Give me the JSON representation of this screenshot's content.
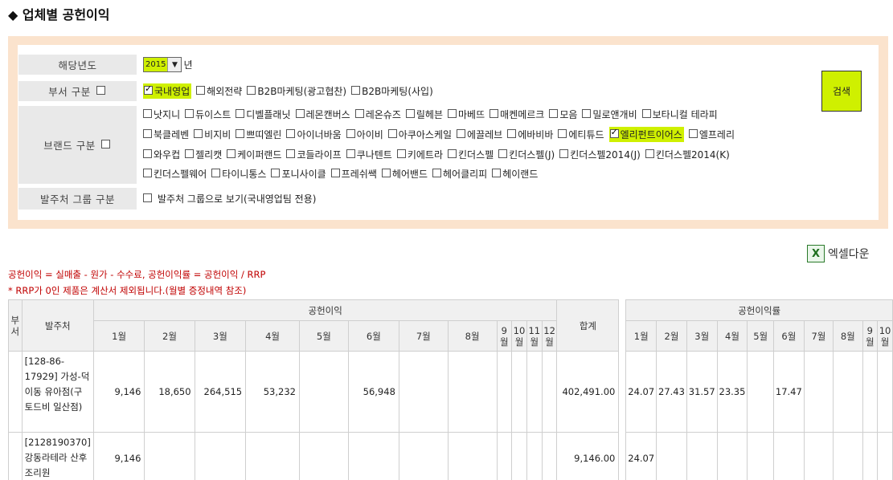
{
  "page": {
    "title": "◆ 업체별 공헌이익"
  },
  "filters": {
    "year": {
      "label": "해당년도",
      "value": "2015",
      "unit": "년"
    },
    "dept": {
      "label": "부서 구분",
      "options": [
        {
          "label": "국내영업",
          "checked": true,
          "highlight": true
        },
        {
          "label": "해외전략",
          "checked": false
        },
        {
          "label": "B2B마케팅(광고협찬)",
          "checked": false
        },
        {
          "label": "B2B마케팅(사입)",
          "checked": false
        }
      ]
    },
    "brand": {
      "label": "브랜드 구분",
      "lines": [
        [
          "낫지니",
          "듀이스트",
          "디벨플래닛",
          "레몬캔버스",
          "레온슈즈",
          "릴헤븐",
          "마베뜨",
          "매켄메르크",
          "모음",
          "밀로앤개비",
          "보타니컬 테라피"
        ],
        [
          "북클레벤",
          "비지비",
          "쁘띠엘린",
          "아이너바움",
          "아이비",
          "아쿠아스케일",
          "에끌레브",
          "에바비바",
          "에티튜드",
          "엘리펀트이어스",
          "엘프레리"
        ],
        [
          "와우컵",
          "젤리캣",
          "케이퍼랜드",
          "코들라이프",
          "쿠나텐트",
          "키에트라",
          "킨더스펠",
          "킨더스펠(J)",
          "킨더스펠2014(J)",
          "킨더스펠2014(K)"
        ],
        [
          "킨더스펠웨어",
          "타이니통스",
          "포니사이클",
          "프레쉬쌕",
          "헤어밴드",
          "헤어클리피",
          "헤이랜드"
        ]
      ],
      "checked": [
        "엘리펀트이어스"
      ]
    },
    "group": {
      "label": "발주처 그룹 구분",
      "option": "발주처 그룹으로 보기(국내영업팀 전용)"
    }
  },
  "actions": {
    "search_label": "검색",
    "excel_label": "엑셀다운",
    "excel_icon": "excel-icon"
  },
  "notes": {
    "formula": "공헌이익 = 실매출 - 원가 - 수수료, 공헌이익률 = 공헌이익 / RRP",
    "rrp_note": "* RRP가 0인 제품은 계산서 제외됩니다.(월별 증정내역 참조)"
  },
  "table": {
    "head": {
      "dept": "부서",
      "vendor": "발주처",
      "profit_group": "공헌이익",
      "total": "합계",
      "rate_group": "공헌이익률",
      "months": [
        "1월",
        "2월",
        "3월",
        "4월",
        "5월",
        "6월",
        "7월",
        "8월",
        "9월",
        "10월",
        "11월",
        "12월"
      ]
    },
    "rows": [
      {
        "dept": "",
        "vendor": "[128-86-17929] 가성-덕이동 유아점(구 토드비 일산점)",
        "profit": [
          "9,146",
          "18,650",
          "264,515",
          "53,232",
          "",
          "56,948",
          "",
          "",
          "",
          "",
          "",
          ""
        ],
        "total": "402,491.00",
        "rate": [
          "24.07",
          "27.43",
          "31.57",
          "23.35",
          "",
          "17.47",
          "",
          "",
          "",
          ""
        ]
      },
      {
        "dept": "",
        "vendor": "[2128190370] 강동라테라 산후조리원",
        "profit": [
          "9,146",
          "",
          "",
          "",
          "",
          "",
          "",
          "",
          "",
          "",
          "",
          ""
        ],
        "total": "9,146.00",
        "rate": [
          "24.07",
          "",
          "",
          "",
          "",
          "",
          "",
          "",
          "",
          ""
        ]
      }
    ]
  }
}
